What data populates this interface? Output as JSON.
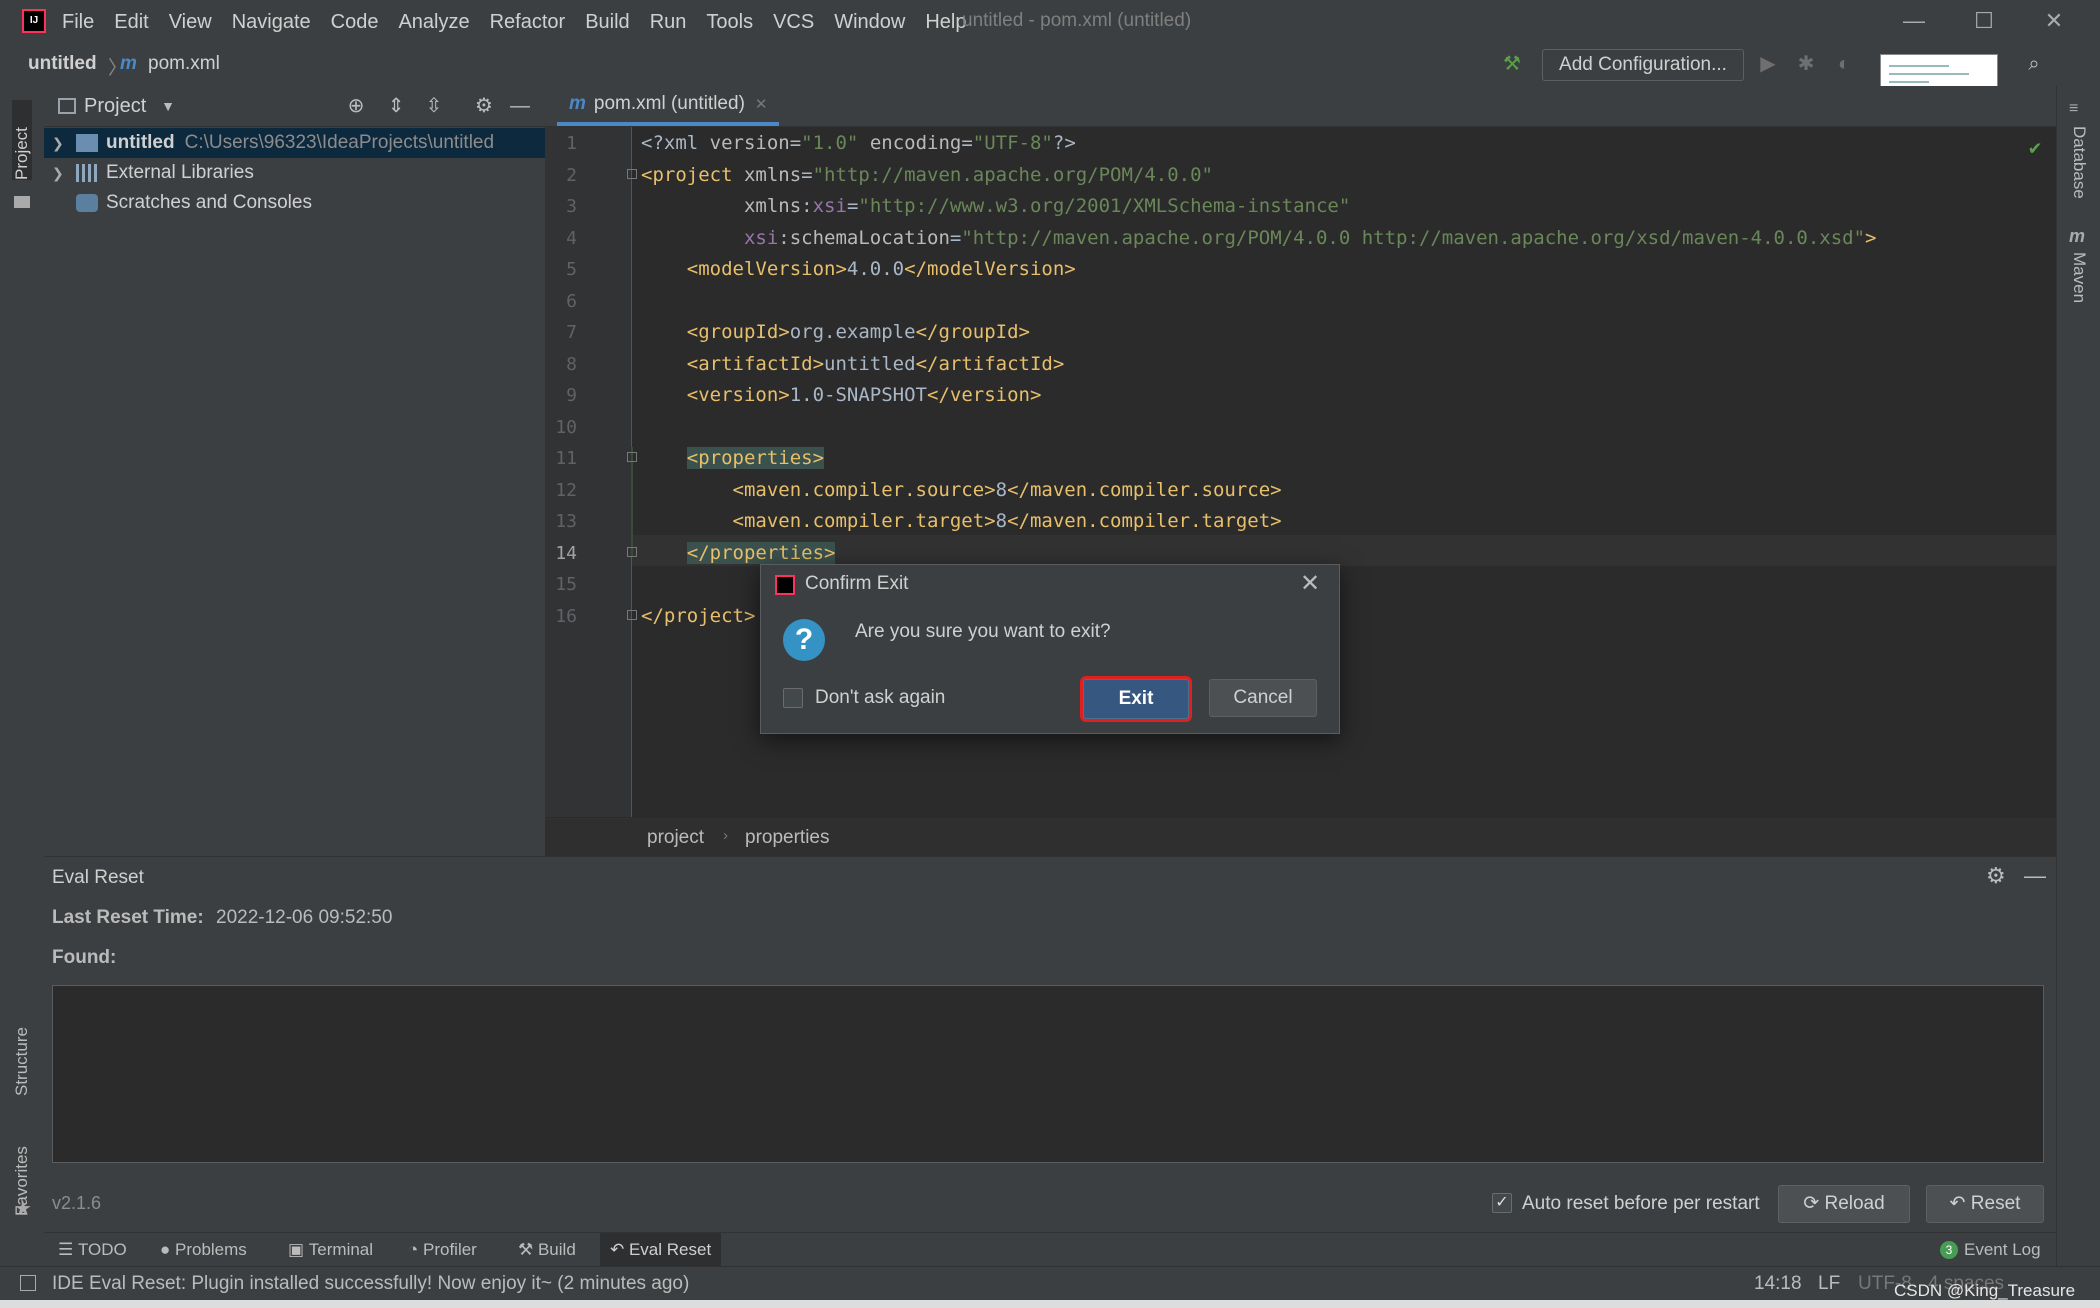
{
  "window": {
    "title": "untitled - pom.xml (untitled)",
    "menu": [
      "File",
      "Edit",
      "View",
      "Navigate",
      "Code",
      "Analyze",
      "Refactor",
      "Build",
      "Run",
      "Tools",
      "VCS",
      "Window",
      "Help"
    ]
  },
  "navbar": {
    "project": "untitled",
    "file": "pom.xml",
    "add_configuration": "Add Configuration..."
  },
  "project_panel": {
    "title": "Project",
    "tree": [
      {
        "label": "untitled",
        "path": "C:\\Users\\96323\\IdeaProjects\\untitled"
      },
      {
        "label": "External Libraries"
      },
      {
        "label": "Scratches and Consoles"
      }
    ]
  },
  "side_stripes": {
    "left_top": "Project",
    "left_structure": "Structure",
    "left_favorites": "Favorites",
    "right_database": "Database",
    "right_maven": "Maven"
  },
  "editor": {
    "tab": "pom.xml (untitled)",
    "line_numbers": [
      "1",
      "2",
      "3",
      "4",
      "5",
      "6",
      "7",
      "8",
      "9",
      "10",
      "11",
      "12",
      "13",
      "14",
      "15",
      "16"
    ],
    "current_line": "14",
    "breadcrumb": [
      "project",
      "properties"
    ]
  },
  "eval_reset": {
    "title": "Eval Reset",
    "last_reset_label": "Last Reset Time:",
    "last_reset_value": "2022-12-06 09:52:50",
    "found_label": "Found:",
    "version": "v2.1.6",
    "auto_reset_label": "Auto reset before per restart",
    "reload_label": "Reload",
    "reset_label": "Reset"
  },
  "bottom_tabs": [
    "TODO",
    "Problems",
    "Terminal",
    "Profiler",
    "Build",
    "Eval Reset"
  ],
  "event_log": {
    "count": "3",
    "label": "Event Log"
  },
  "status": {
    "message": "IDE Eval Reset: Plugin installed successfully! Now enjoy it~ (2 minutes ago)",
    "position": "14:18",
    "line_sep": "LF",
    "encoding": "UTF-8",
    "indent": "4 spaces",
    "watermark": "CSDN @King_Treasure"
  },
  "dialog": {
    "title": "Confirm Exit",
    "message": "Are you sure you want to exit?",
    "checkbox_label": "Don't ask again",
    "exit_label": "Exit",
    "cancel_label": "Cancel"
  },
  "colors": {
    "background": "#2b2b2b",
    "panel": "#3c3f41",
    "accent_blue": "#365880",
    "xml_tag": "#e8bf6a",
    "xml_value": "#6a8759",
    "xml_namespace": "#9876aa",
    "highlight_box": "#e02020"
  }
}
